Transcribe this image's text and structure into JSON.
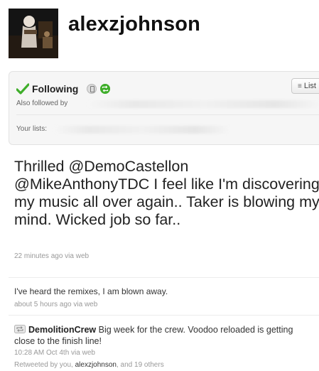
{
  "profile": {
    "username": "alexzjohnson"
  },
  "follow_box": {
    "following_label": "Following",
    "lists_button_label": "List",
    "also_followed_label": "Also followed by",
    "your_lists_label": "Your lists:"
  },
  "main_tweet": {
    "text": "Thrilled @DemoCastellon @MikeAnthonyTDC I feel like I'm discovering my music all over again.. Taker is blowing my mind. Wicked job so far..",
    "meta": "22 minutes ago via web"
  },
  "tweets": [
    {
      "text": "I've heard the remixes, I am blown away.",
      "meta": "about 5 hours ago via web"
    },
    {
      "retweet_user": "DemolitionCrew",
      "text": "Big week for the crew. Voodoo reloaded is getting close to the finish line!",
      "meta": "10:28 AM Oct 4th via web",
      "retweeted_prefix": "Retweeted by you,",
      "retweeted_user": "alexzjohnson",
      "retweeted_suffix": ", and 19 others"
    }
  ],
  "colors": {
    "follow_check": "#3fae2a",
    "meta_text": "#999999",
    "box_background": "#f6f6f6"
  }
}
